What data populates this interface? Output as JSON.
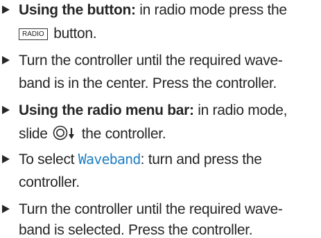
{
  "items": [
    {
      "bold": "Using the button:",
      "line1_rest": " in radio mode press the",
      "key_label": "RADIO",
      "line2_rest": " button."
    },
    {
      "line1": "Turn the controller until the required wave-",
      "line2": "band is in the center. Press the controller."
    },
    {
      "bold": "Using the radio menu bar:",
      "line1_rest": " in radio mode,",
      "line2_a": "slide ",
      "icon": "controller-slide-down-icon",
      "line2_b": " the controller."
    },
    {
      "line1_a": "To select ",
      "highlight": "Waveband",
      "line1_b": ": turn and press the",
      "line2": "controller."
    },
    {
      "line1": "Turn the controller until the required wave-",
      "line2": "band is selected. Press the controller."
    }
  ],
  "colors": {
    "text": "#262626",
    "highlight": "#1f7fc6"
  }
}
